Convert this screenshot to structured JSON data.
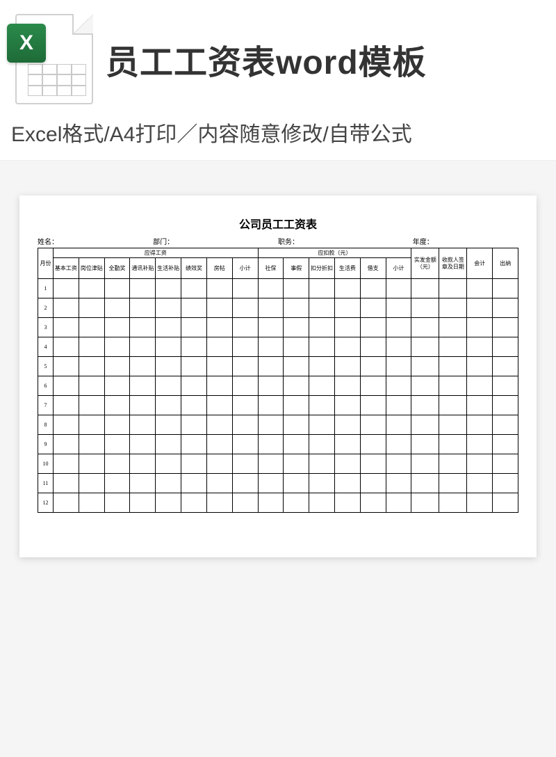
{
  "header": {
    "icon_letter": "X",
    "title": "员工工资表word模板",
    "subline": "Excel格式/A4打印／内容随意修改/自带公式"
  },
  "sheet": {
    "title": "公司员工工资表",
    "info": {
      "name_label": "姓名：",
      "dept_label": "部门：",
      "post_label": "职务：",
      "year_label": "年度："
    },
    "groups": {
      "month": "月份",
      "due_pay": "应得工资",
      "deduct": "应扣款（元）",
      "actual": "实发金额（元）",
      "sign": "收款人签章及日期",
      "accountant": "会计",
      "cashier": "出纳"
    },
    "columns_due": [
      "基本工资",
      "岗位津贴",
      "全勤奖",
      "通讯补贴",
      "生活补贴",
      "绩效奖",
      "房帖",
      "小计"
    ],
    "columns_deduct": [
      "社保",
      "事假",
      "扣分折扣",
      "生活费",
      "借支",
      "小计"
    ],
    "row_numbers": [
      "1",
      "2",
      "3",
      "4",
      "5",
      "6",
      "7",
      "8",
      "9",
      "10",
      "11",
      "12"
    ]
  }
}
